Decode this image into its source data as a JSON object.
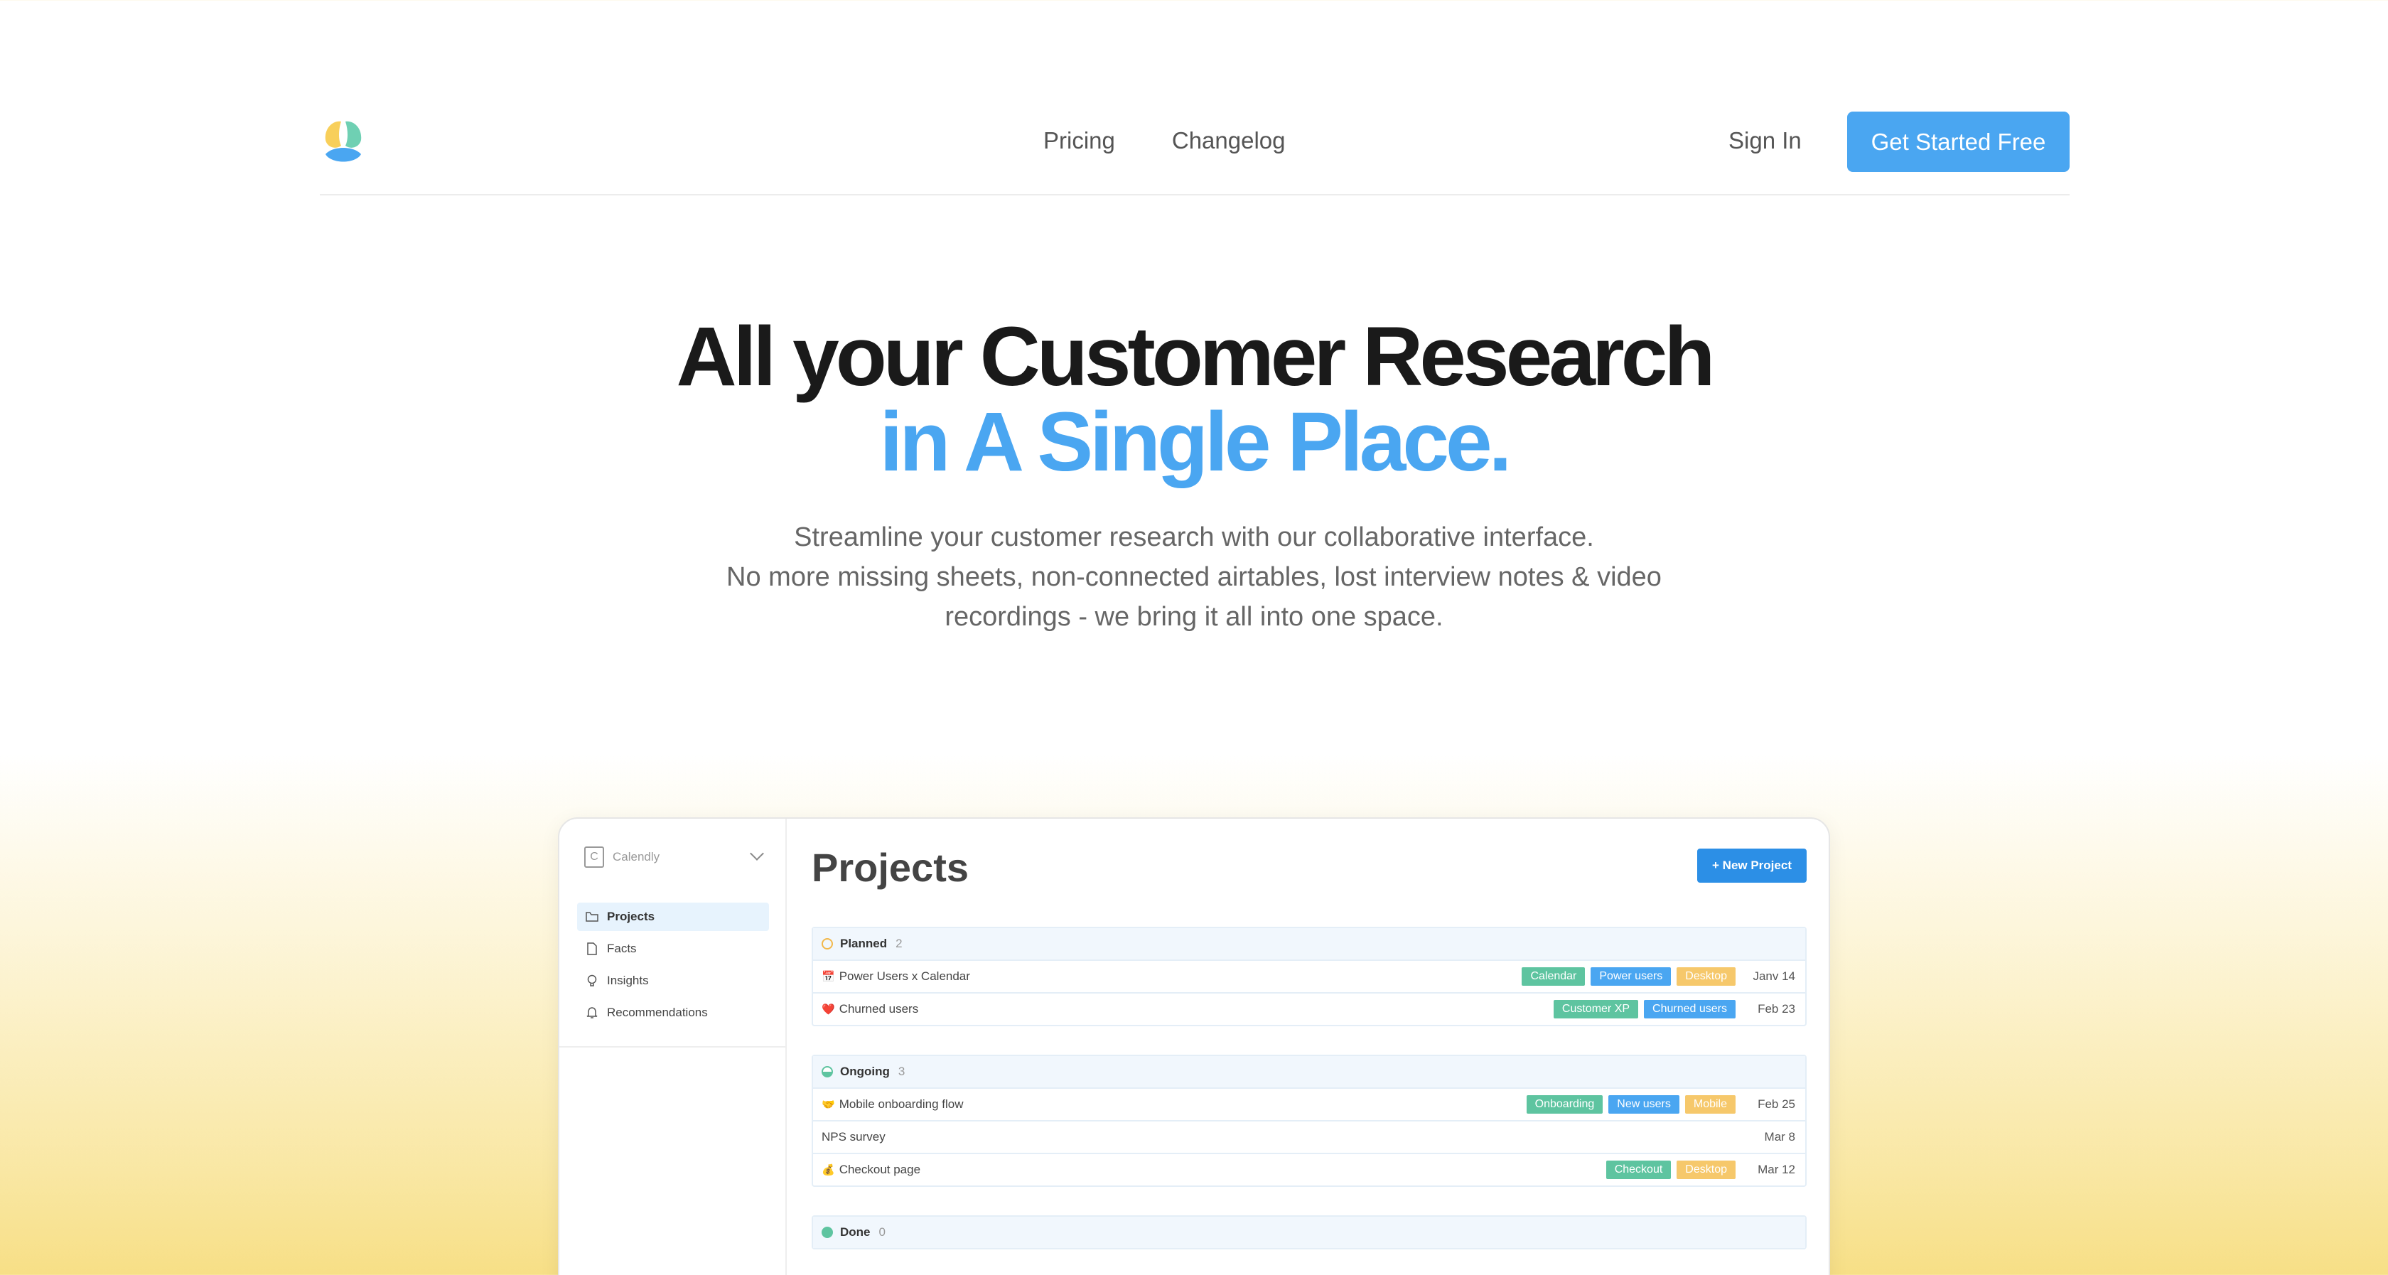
{
  "nav": {
    "links": [
      "Pricing",
      "Changelog"
    ],
    "sign_in": "Sign In",
    "cta": "Get Started Free"
  },
  "hero": {
    "title_line1": "All your Customer Research",
    "title_line2": "in A Single Place.",
    "subtitle_line1": "Streamline your customer research with our collaborative interface.",
    "subtitle_line2": "No more missing sheets, non-connected airtables, lost interview notes & video recordings - we bring it all into one space."
  },
  "app": {
    "workspace": {
      "icon_letter": "C",
      "name": "Calendly"
    },
    "sidebar": [
      {
        "label": "Projects",
        "icon": "folder-icon",
        "active": true
      },
      {
        "label": "Facts",
        "icon": "file-icon",
        "active": false
      },
      {
        "label": "Insights",
        "icon": "lightbulb-icon",
        "active": false
      },
      {
        "label": "Recommendations",
        "icon": "bell-icon",
        "active": false
      }
    ],
    "page_title": "Projects",
    "new_button": "+ New Project",
    "groups": [
      {
        "name": "Planned",
        "count": "2",
        "status_color": "#f2b84b",
        "status_style": "ring",
        "rows": [
          {
            "emoji": "📅",
            "name": "Power Users x Calendar",
            "tags": [
              {
                "label": "Calendar",
                "color": "#5ec4a0"
              },
              {
                "label": "Power users",
                "color": "#4aa6f1"
              },
              {
                "label": "Desktop",
                "color": "#f6c86b"
              }
            ],
            "date": "Janv 14"
          },
          {
            "emoji": "❤️",
            "name": "Churned users",
            "tags": [
              {
                "label": "Customer XP",
                "color": "#5ec4a0"
              },
              {
                "label": "Churned users",
                "color": "#4aa6f1"
              }
            ],
            "date": "Feb 23"
          }
        ]
      },
      {
        "name": "Ongoing",
        "count": "3",
        "status_color": "#5ec4a0",
        "status_style": "half",
        "rows": [
          {
            "emoji": "🤝",
            "name": "Mobile onboarding flow",
            "tags": [
              {
                "label": "Onboarding",
                "color": "#5ec4a0"
              },
              {
                "label": "New users",
                "color": "#4aa6f1"
              },
              {
                "label": "Mobile",
                "color": "#f6c86b"
              }
            ],
            "date": "Feb 25"
          },
          {
            "emoji": "",
            "name": "NPS survey",
            "tags": [],
            "date": "Mar 8"
          },
          {
            "emoji": "💰",
            "name": "Checkout page",
            "tags": [
              {
                "label": "Checkout",
                "color": "#5ec4a0"
              },
              {
                "label": "Desktop",
                "color": "#f6c86b"
              }
            ],
            "date": "Mar 12"
          }
        ]
      },
      {
        "name": "Done",
        "count": "0",
        "status_color": "#5ec4a0",
        "status_style": "full",
        "rows": []
      }
    ]
  }
}
